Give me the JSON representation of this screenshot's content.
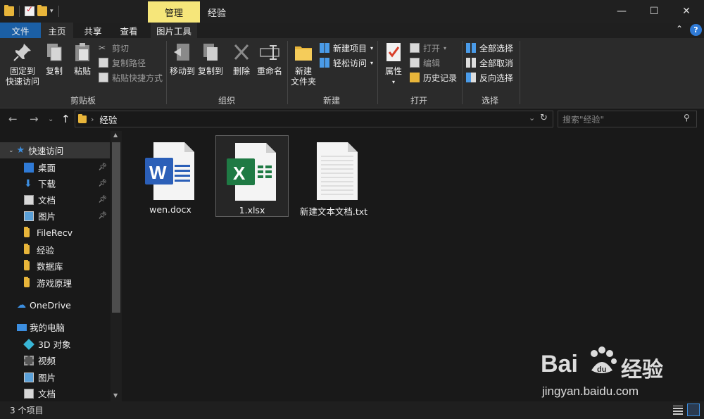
{
  "titlebar": {
    "manage_tab": "管理",
    "title": "经验",
    "minimize_glyph": "—",
    "maximize_glyph": "☐",
    "close_glyph": "✕"
  },
  "tabs": {
    "file": "文件",
    "home": "主页",
    "share": "共享",
    "view": "查看",
    "picture_tools": "图片工具"
  },
  "ribbon": {
    "clipboard": {
      "label": "剪贴板",
      "pin_line1": "固定到",
      "pin_line2": "快速访问",
      "copy": "复制",
      "paste": "粘贴",
      "cut": "剪切",
      "copy_path": "复制路径",
      "paste_shortcut": "粘贴快捷方式"
    },
    "organize": {
      "label": "组织",
      "move_to": "移动到",
      "copy_to": "复制到",
      "delete": "删除",
      "rename": "重命名"
    },
    "new": {
      "label": "新建",
      "new_folder_line1": "新建",
      "new_folder_line2": "文件夹",
      "new_item": "新建项目",
      "easy_access": "轻松访问"
    },
    "open": {
      "label": "打开",
      "properties": "属性",
      "open": "打开",
      "edit": "编辑",
      "history": "历史记录"
    },
    "select": {
      "label": "选择",
      "select_all": "全部选择",
      "select_none": "全部取消",
      "invert": "反向选择"
    }
  },
  "address": {
    "current": "经验",
    "search_placeholder": "搜索\"经验\""
  },
  "sidebar": {
    "quick_access": "快速访问",
    "items": [
      {
        "label": "桌面"
      },
      {
        "label": "下载"
      },
      {
        "label": "文档"
      },
      {
        "label": "图片"
      },
      {
        "label": "FileRecv"
      },
      {
        "label": "经验"
      },
      {
        "label": "数据库"
      },
      {
        "label": "游戏原理"
      }
    ],
    "onedrive": "OneDrive",
    "this_pc": "我的电脑",
    "pc_items": [
      {
        "label": "3D 对象"
      },
      {
        "label": "视频"
      },
      {
        "label": "图片"
      },
      {
        "label": "文档"
      }
    ]
  },
  "files": [
    {
      "name": "wen.docx",
      "type": "word",
      "icon_letter": "W"
    },
    {
      "name": "1.xlsx",
      "type": "excel",
      "icon_letter": "X"
    },
    {
      "name": "新建文本文档.txt",
      "type": "text"
    }
  ],
  "status": {
    "item_count": "3 个项目"
  },
  "watermark": {
    "brand_left": "Bai",
    "brand_right": "经验",
    "url": "jingyan.baidu.com"
  },
  "colors": {
    "file_tab": "#1b5fa5",
    "manage_tab": "#f6e67a",
    "word": "#2b5fb8",
    "excel": "#1f7a44",
    "folder": "#e8b53a"
  }
}
